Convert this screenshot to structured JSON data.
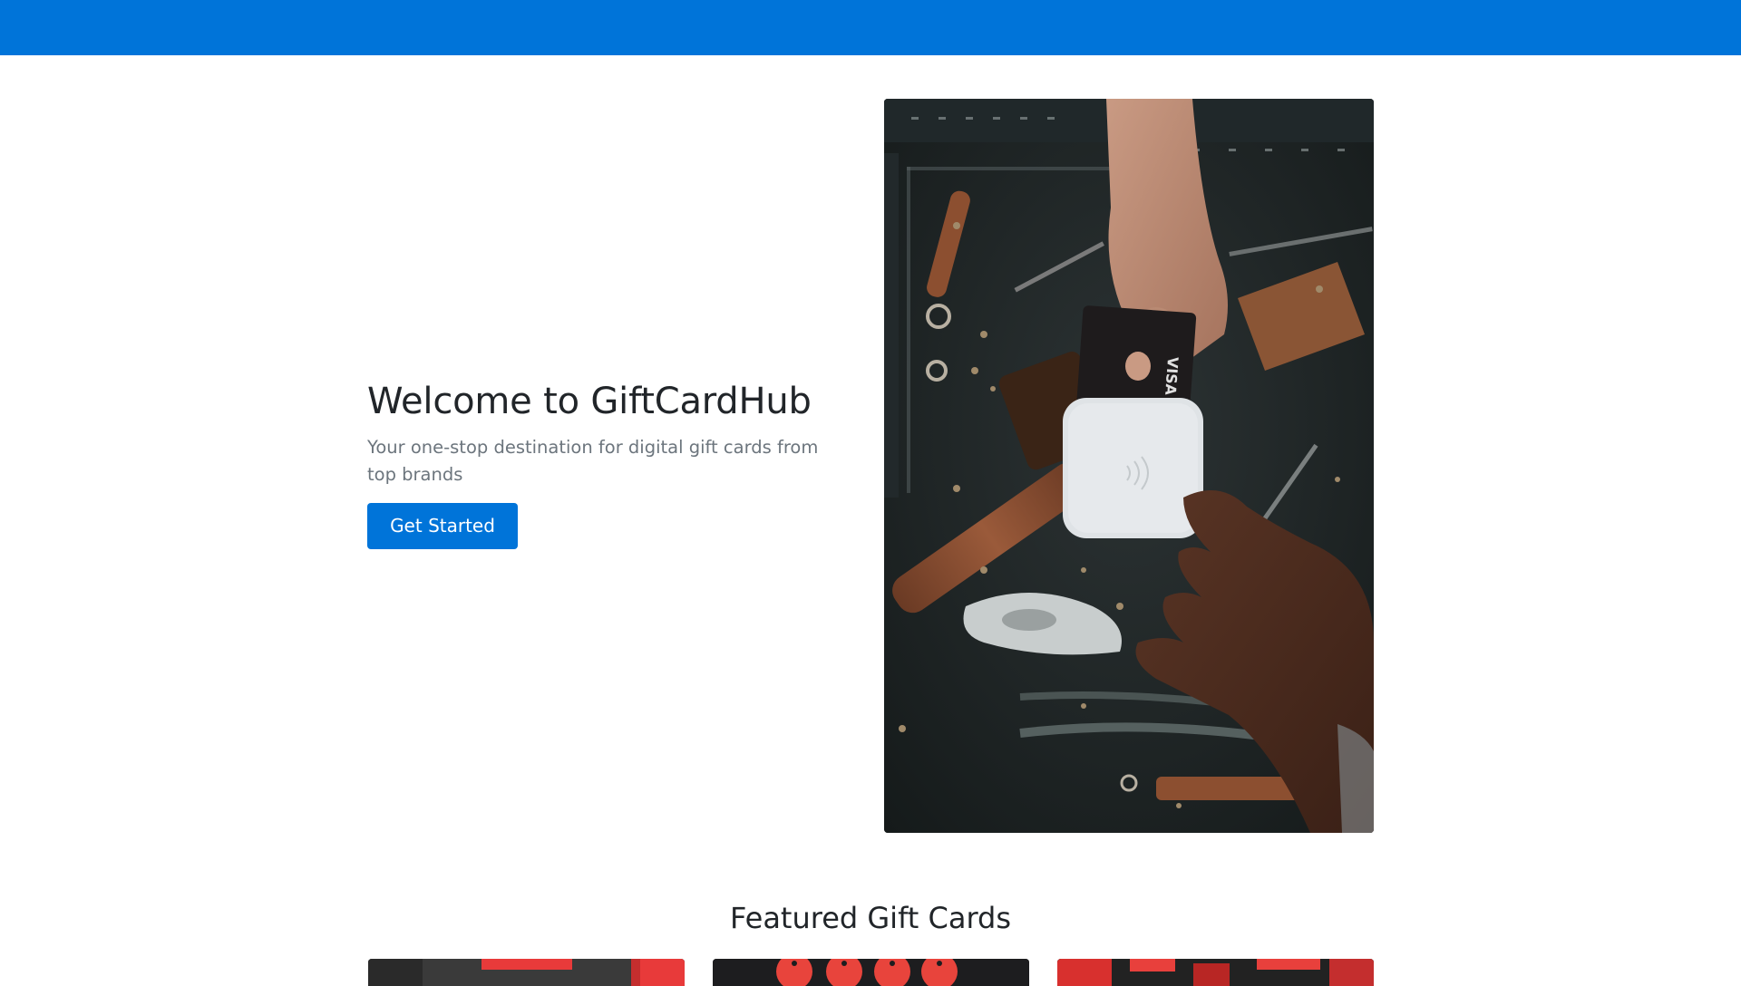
{
  "header": {
    "color": "#0074d9"
  },
  "hero": {
    "title": "Welcome to GiftCardHub",
    "subtitle": "Your one-stop destination for digital gift cards from top brands",
    "cta_label": "Get Started",
    "image_icon": "payment-terminal-photo",
    "card_brand_text": "VISA"
  },
  "featured": {
    "title": "Featured Gift Cards",
    "cards": [
      {
        "image_icon": "gift-card-image"
      },
      {
        "image_icon": "gift-card-image"
      },
      {
        "image_icon": "gift-card-image"
      }
    ]
  },
  "colors": {
    "accent": "#0074d9",
    "text": "#212529",
    "muted": "#6c757d"
  }
}
